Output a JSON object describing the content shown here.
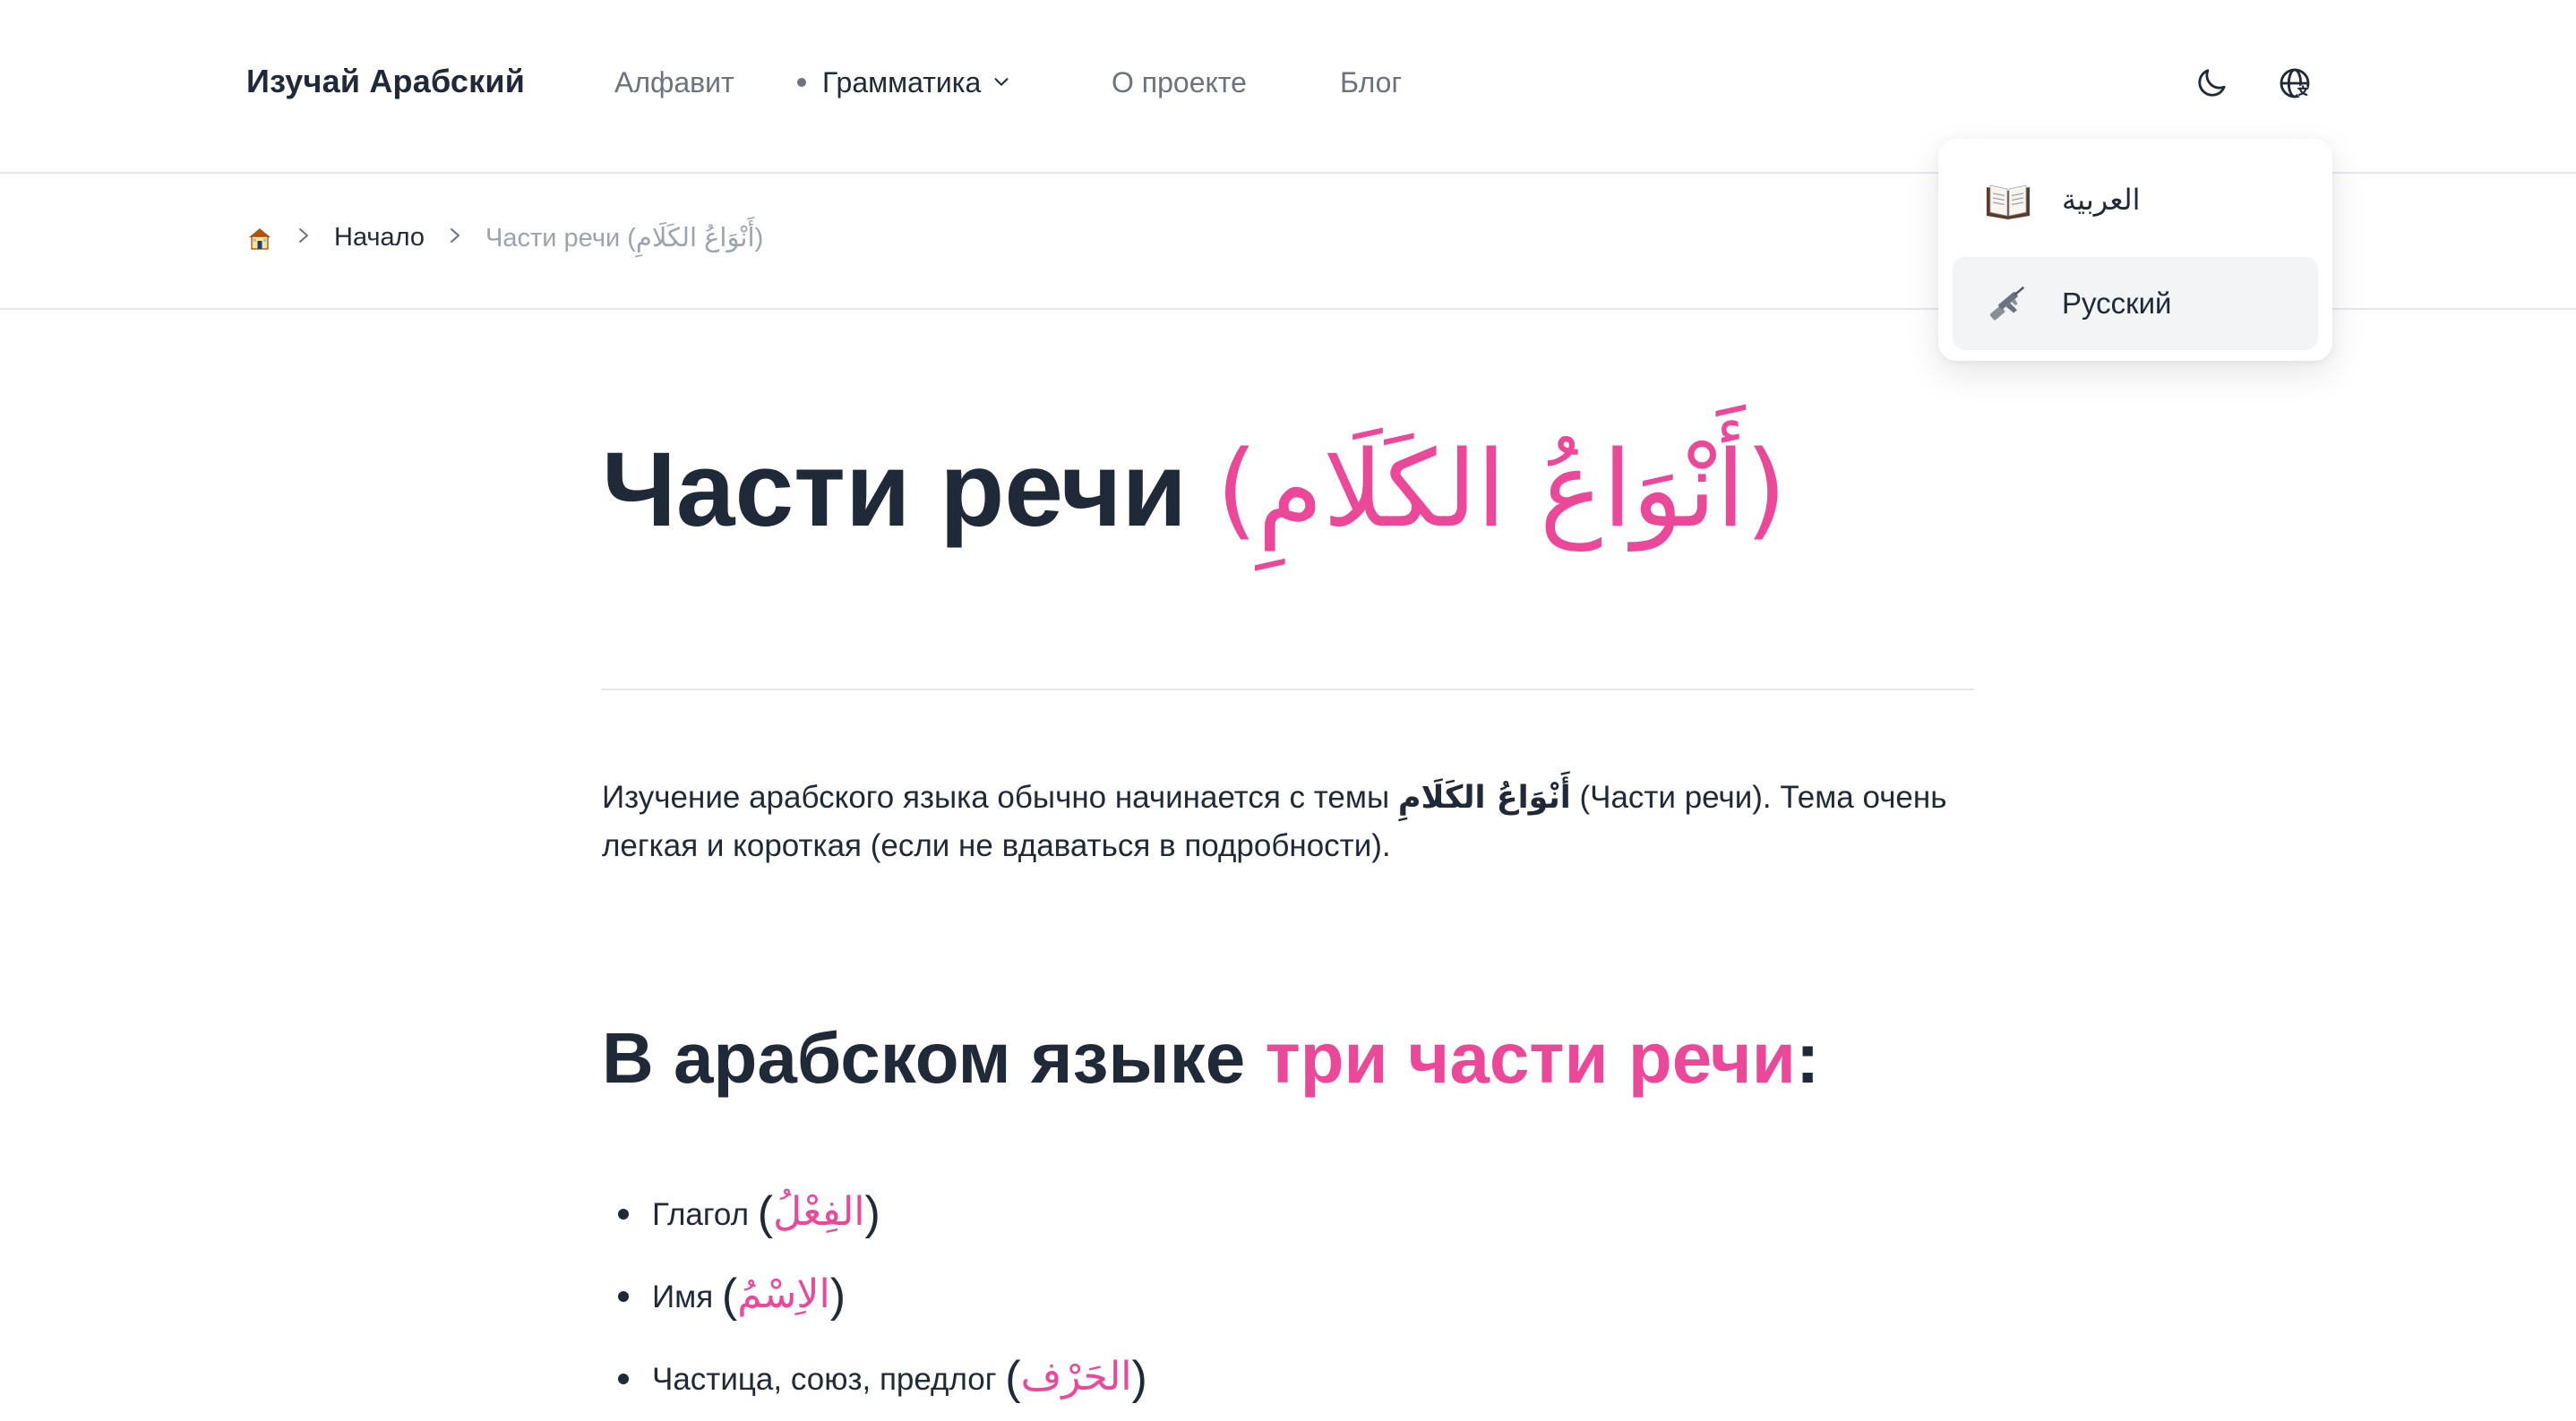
{
  "header": {
    "brand": "Изучай Арабский",
    "nav": {
      "alphabet": "Алфавит",
      "grammar": "Грамматика",
      "about": "О проекте",
      "blog": "Блог"
    }
  },
  "breadcrumb": {
    "home_icon": "house-icon",
    "start": "Начало",
    "current": "Части речи (أَنْوَاعُ الكَلَامِ)"
  },
  "page": {
    "title_ru": "Части речи",
    "title_ar": "(أَنْوَاعُ الكَلَامِ)",
    "intro_before": "Изучение арабского языка обычно начинается с темы ",
    "intro_ar": "أَنْوَاعُ الكَلَامِ",
    "intro_after": " (Части речи). Тема очень легкая и короткая (если не вдаваться в подробности).",
    "section_heading_before": "В арабском языке ",
    "section_heading_accent": "три части речи",
    "section_heading_after": ":",
    "parts": [
      {
        "label": "Глагол",
        "ar": "الفِعْلُ"
      },
      {
        "label": "Имя",
        "ar": "الاِسْمُ"
      },
      {
        "label": "Частица, союз, предлог",
        "ar": "الحَرْف"
      }
    ]
  },
  "language_menu": {
    "options": [
      {
        "label": "العربية",
        "icon": "open-book-icon",
        "active": false
      },
      {
        "label": "Русский",
        "icon": "rifle-icon",
        "active": true
      }
    ]
  },
  "colors": {
    "accent": "#ec4899",
    "text": "#1f2937",
    "muted": "#6b7280",
    "active_bg": "#f3f4f6"
  }
}
